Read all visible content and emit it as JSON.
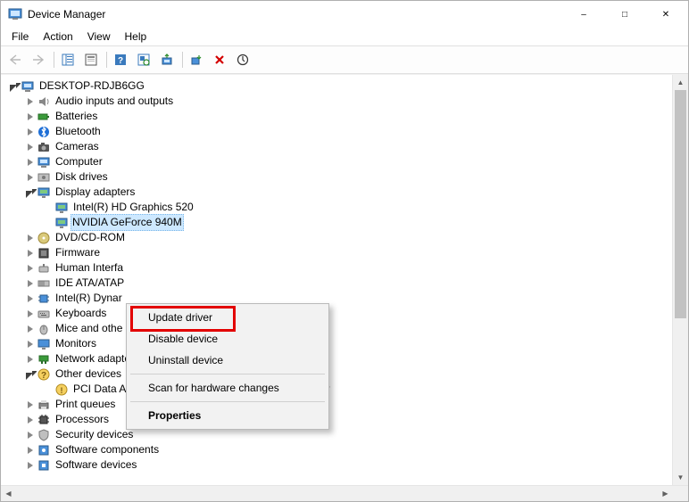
{
  "title": "Device Manager",
  "menu": {
    "file": "File",
    "action": "Action",
    "view": "View",
    "help": "Help"
  },
  "root_device": "DESKTOP-RDJB6GG",
  "categories": {
    "audio": "Audio inputs and outputs",
    "batteries": "Batteries",
    "bluetooth": "Bluetooth",
    "cameras": "Cameras",
    "computer": "Computer",
    "disk": "Disk drives",
    "display": "Display adapters",
    "display_item1": "Intel(R) HD Graphics 520",
    "display_item2": "NVIDIA GeForce 940M",
    "dvd": "DVD/CD-ROM",
    "firmware": "Firmware",
    "hid": "Human Interfa",
    "ide": "IDE ATA/ATAP",
    "intel_dyn": "Intel(R) Dynar",
    "keyboards": "Keyboards",
    "mice": "Mice and othe",
    "monitors": "Monitors",
    "network": "Network adapters",
    "other": "Other devices",
    "other_item1": "PCI Data Acquisition and Signal Processing Controller",
    "print": "Print queues",
    "processors": "Processors",
    "security": "Security devices",
    "softcomp": "Software components",
    "softdev": "Software devices"
  },
  "context_menu": {
    "update": "Update driver",
    "disable": "Disable device",
    "uninstall": "Uninstall device",
    "scan": "Scan for hardware changes",
    "properties": "Properties"
  }
}
